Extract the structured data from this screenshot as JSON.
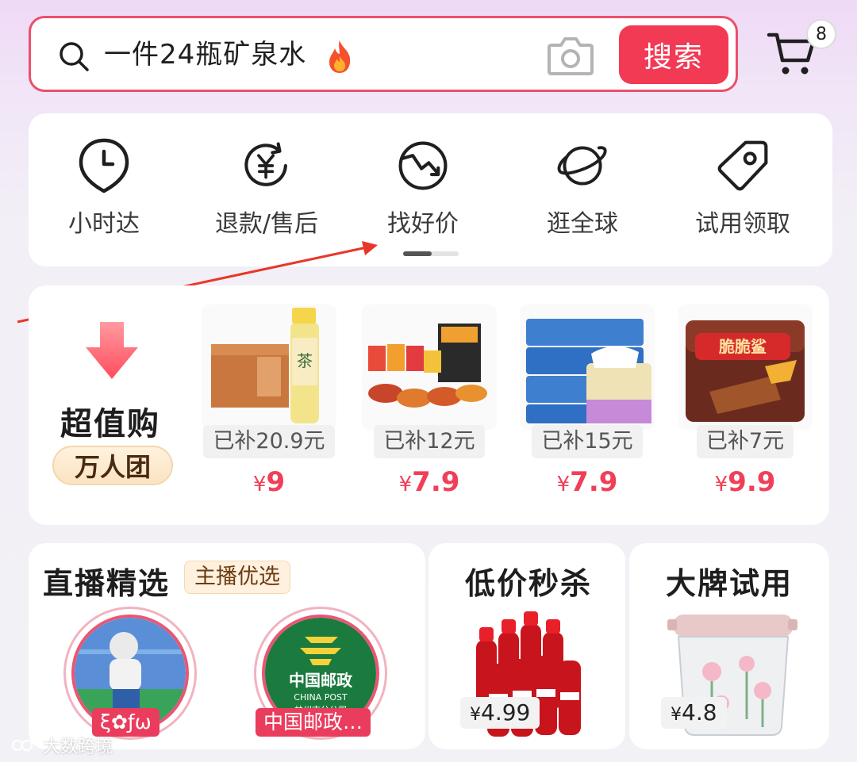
{
  "search": {
    "query": "一件24瓶矿泉水",
    "button_label": "搜索"
  },
  "cart": {
    "count": "8"
  },
  "services": [
    {
      "icon": "clock-pin-icon",
      "label": "小时达"
    },
    {
      "icon": "refund-yen-icon",
      "label": "退款/售后"
    },
    {
      "icon": "price-down-icon",
      "label": "找好价"
    },
    {
      "icon": "planet-icon",
      "label": "逛全球"
    },
    {
      "icon": "tag-icon",
      "label": "试用领取"
    }
  ],
  "deals": {
    "title": "超值购",
    "badge": "万人团",
    "items": [
      {
        "subsidy": "已补20.9元",
        "price": "9",
        "image": "tea-drink-case"
      },
      {
        "subsidy": "已补12元",
        "price": "7.9",
        "image": "snack-bundle"
      },
      {
        "subsidy": "已补15元",
        "price": "7.9",
        "image": "tissue-pack"
      },
      {
        "subsidy": "已补7元",
        "price": "9.9",
        "image": "nestle-wafer"
      }
    ],
    "currency": "¥"
  },
  "live": {
    "title": "直播精选",
    "tag": "主播优选",
    "anchors": [
      {
        "name": "ξ✿ƒω"
      },
      {
        "name": "中国邮政…",
        "logo_line1": "中国邮政",
        "logo_line2": "CHINA POST",
        "logo_line3": "林州市分公司"
      }
    ]
  },
  "flash_sale": {
    "title": "低价秒杀",
    "price": "4.99",
    "image": "cola-bottles"
  },
  "brand_trial": {
    "title": "大牌试用",
    "price": "4.8",
    "image": "glass-container"
  },
  "watermark": "大数跨境",
  "colors": {
    "accent": "#f23a55",
    "price": "#f03f57",
    "badge_bg": "#ea3c5c"
  }
}
